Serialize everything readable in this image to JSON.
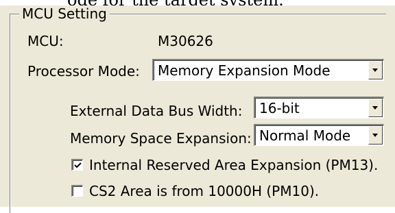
{
  "top_text": "ode for the target system.",
  "group": {
    "title": "MCU Setting"
  },
  "mcu": {
    "label": "MCU:",
    "value": "M30626"
  },
  "processor_mode": {
    "label": "Processor Mode:",
    "selected": "Memory Expansion Mode"
  },
  "external_bus": {
    "label": "External Data Bus Width:",
    "selected": "16-bit"
  },
  "memory_space": {
    "label": "Memory Space Expansion:",
    "selected": "Normal Mode"
  },
  "options": [
    {
      "label": "Internal Reserved Area Expansion (PM13).",
      "checked": true
    },
    {
      "label": "CS2 Area is from 10000H (PM10).",
      "checked": false
    }
  ],
  "icons": {
    "dropdown": "chevron-down-icon",
    "check": "checkmark-icon"
  },
  "colors": {
    "dialog_face": "#ece9d8",
    "field_bg": "#ffffff",
    "shadow": "#808080"
  }
}
